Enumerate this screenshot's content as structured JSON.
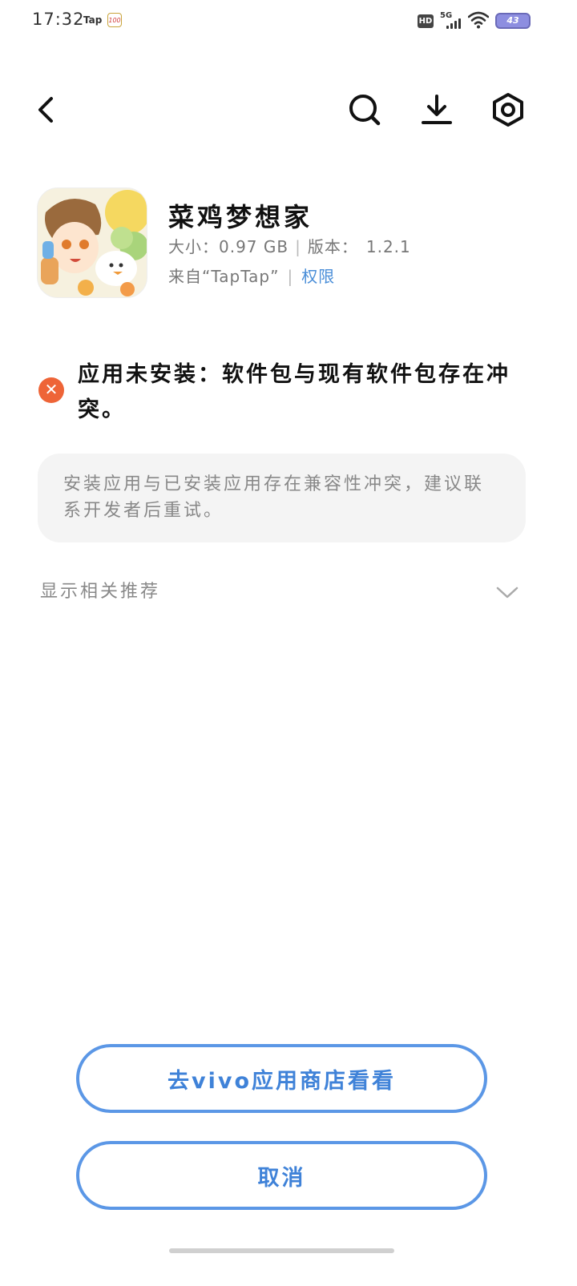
{
  "status_bar": {
    "time": "17:32",
    "tap_logo": "Tap",
    "calendar_badge": "100",
    "hd_label": "HD",
    "network": "5G",
    "battery": "43"
  },
  "header": {
    "back_icon": "chevron-left-icon",
    "search_icon": "search-icon",
    "download_icon": "download-icon",
    "settings_icon": "hexagon-gear-icon"
  },
  "app": {
    "name": "菜鸡梦想家",
    "size_label": "大小：",
    "size_value": "0.97 GB",
    "version_label": "版本：",
    "version_value": "1.2.1",
    "source": "来自“TapTap”",
    "permission_link": "权限"
  },
  "error": {
    "icon": "close-circle-icon",
    "message": "应用未安装：软件包与现有软件包存在冲突。",
    "detail": "安装应用与已安装应用存在兼容性冲突，建议联系开发者后重试。"
  },
  "recommendations": {
    "label": "显示相关推荐",
    "icon": "chevron-down-icon"
  },
  "buttons": {
    "store": "去vivo应用商店看看",
    "cancel": "取消"
  },
  "colors": {
    "accent": "#5b97e6",
    "error": "#ee6437",
    "battery": "#8d8ee0"
  }
}
